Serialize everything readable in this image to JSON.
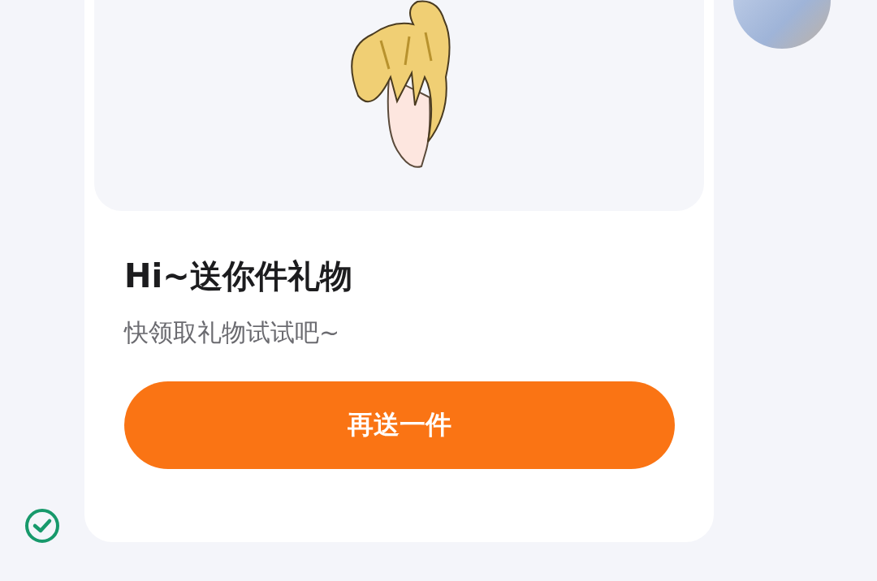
{
  "message": {
    "sent": true,
    "title": "Hi~送你件礼物",
    "subtitle": "快领取礼物试试吧~",
    "button": "再送一件"
  }
}
